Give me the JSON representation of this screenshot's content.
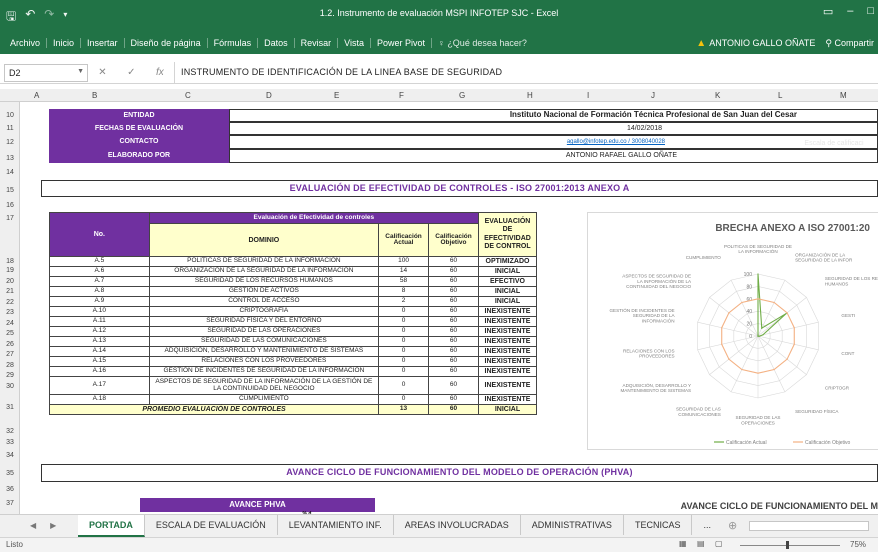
{
  "window": {
    "title": "1.2. Instrumento de evaluación  MSPI INFOTEP SJC - Excel",
    "controls": [
      "▭",
      "–",
      "□"
    ]
  },
  "ribbon": {
    "tabs": [
      "Archivo",
      "Inicio",
      "Insertar",
      "Diseño de página",
      "Fórmulas",
      "Datos",
      "Revisar",
      "Vista",
      "Power Pivot"
    ],
    "tell_me": "¿Qué desea hacer?",
    "user": "ANTONIO GALLO OÑATE",
    "share": "Compartir"
  },
  "formula_bar": {
    "name_box": "D2",
    "formula": "INSTRUMENTO DE IDENTIFICACIÓN DE LA LINEA BASE DE SEGURIDAD"
  },
  "columns": [
    "A",
    "B",
    "C",
    "D",
    "E",
    "F",
    "G",
    "H",
    "I",
    "J",
    "K",
    "L",
    "M"
  ],
  "rows": [
    "10",
    "11",
    "12",
    "13",
    "14",
    "15",
    "16",
    "17",
    "18",
    "19",
    "20",
    "21",
    "22",
    "23",
    "24",
    "25",
    "26",
    "27",
    "28",
    "29",
    "30",
    "31",
    "32",
    "33",
    "34",
    "35",
    "36",
    "37"
  ],
  "info": {
    "entidad_label": "ENTIDAD",
    "entidad_value": "Instituto Nacional de Formación Técnica Profesional de San Juan del Cesar",
    "fecha_label": "FECHAS DE EVALUACIÓN",
    "fecha_value": "14/02/2018",
    "contacto_label": "CONTACTO",
    "contacto_value": "agallo@infotep.edu.co / 3008040028",
    "elaborado_label": "ELABORADO POR",
    "elaborado_value": "ANTONIO RAFAEL GALLO OÑATE",
    "faded_right": "Escala de calificaci"
  },
  "section1_title": "EVALUACIÓN DE EFECTIVIDAD DE CONTROLES -  ISO 27001:2013 ANEXO A",
  "eval_table": {
    "group_header": "Evaluación de Efectividad de controles",
    "col_no": "No.",
    "col_dominio": "DOMINIO",
    "col_actual": "Calificación Actual",
    "col_objetivo": "Calificación Objetivo",
    "col_eval": "EVALUACIÓN DE EFECTIVIDAD DE CONTROL",
    "rows": [
      {
        "no": "A.5",
        "dominio": "POLITICAS DE SEGURIDAD DE LA INFORMACIÓN",
        "actual": "100",
        "objetivo": "60",
        "eval": "OPTIMIZADO"
      },
      {
        "no": "A.6",
        "dominio": "ORGANIZACIÓN DE LA SEGURIDAD DE LA INFORMACIÓN",
        "actual": "14",
        "objetivo": "60",
        "eval": "INICIAL"
      },
      {
        "no": "A.7",
        "dominio": "SEGURIDAD DE LOS RECURSOS HUMANOS",
        "actual": "58",
        "objetivo": "60",
        "eval": "EFECTIVO"
      },
      {
        "no": "A.8",
        "dominio": "GESTIÓN DE ACTIVOS",
        "actual": "8",
        "objetivo": "60",
        "eval": "INICIAL"
      },
      {
        "no": "A.9",
        "dominio": "CONTROL DE ACCESO",
        "actual": "2",
        "objetivo": "60",
        "eval": "INICIAL"
      },
      {
        "no": "A.10",
        "dominio": "CRIPTOGRAFÍA",
        "actual": "0",
        "objetivo": "60",
        "eval": "INEXISTENTE"
      },
      {
        "no": "A.11",
        "dominio": "SEGURIDAD FÍSICA Y DEL ENTORNO",
        "actual": "0",
        "objetivo": "60",
        "eval": "INEXISTENTE"
      },
      {
        "no": "A.12",
        "dominio": "SEGURIDAD DE LAS OPERACIONES",
        "actual": "0",
        "objetivo": "60",
        "eval": "INEXISTENTE"
      },
      {
        "no": "A.13",
        "dominio": "SEGURIDAD DE LAS COMUNICACIONES",
        "actual": "0",
        "objetivo": "60",
        "eval": "INEXISTENTE"
      },
      {
        "no": "A.14",
        "dominio": "ADQUISICIÓN, DESARROLLO Y MANTENIMIENTO DE SISTEMAS",
        "actual": "0",
        "objetivo": "60",
        "eval": "INEXISTENTE"
      },
      {
        "no": "A.15",
        "dominio": "RELACIONES CON LOS PROVEEDORES",
        "actual": "0",
        "objetivo": "60",
        "eval": "INEXISTENTE"
      },
      {
        "no": "A.16",
        "dominio": "GESTIÓN DE INCIDENTES DE SEGURIDAD DE LA INFORMACIÓN",
        "actual": "0",
        "objetivo": "60",
        "eval": "INEXISTENTE"
      },
      {
        "no": "A.17",
        "dominio": "ASPECTOS DE SEGURIDAD DE LA INFORMACIÓN DE LA GESTIÓN DE LA CONTINUIDAD DEL NEGOCIO",
        "actual": "0",
        "objetivo": "60",
        "eval": "INEXISTENTE"
      },
      {
        "no": "A.18",
        "dominio": "CUMPLIMIENTO",
        "actual": "0",
        "objetivo": "60",
        "eval": "INEXISTENTE"
      }
    ],
    "avg_label": "PROMEDIO EVALUACIÓN DE CONTROLES",
    "avg_actual": "13",
    "avg_objetivo": "60",
    "avg_eval": "INICIAL"
  },
  "section2_title": "AVANCE CICLO DE FUNCIONAMIENTO DEL MODELO DE OPERACIÓN (PHVA)",
  "phva": {
    "header": "AVANCE PHVA",
    "sub": "% d"
  },
  "chart2_title": "AVANCE CICLO DE FUNCIONAMIENTO DEL M",
  "chart_data": {
    "type": "radar",
    "title": "BRECHA ANEXO A ISO 27001:20",
    "axes": [
      "POLITICAS DE SEGURIDAD DE LA INFORMACIÓN",
      "ORGANIZACIÓN DE LA SEGURIDAD DE LA INFOR",
      "SEGURIDAD DE LOS RECURSOS HUMANOS",
      "GESTI",
      "CONT",
      "CRIPTOGR",
      "SEGURIDAD FÍSICA",
      "SEGURIDAD DE LAS OPERACIONES",
      "SEGURIDAD DE LAS COMUNICACIONES",
      "ADQUISICIÓN, DESARROLLO Y MANTENIMIENTO DE SISTEMAS",
      "RELACIONES CON LOS PROVEEDORES",
      "GESTIÓN DE INCIDENTES DE SEGURIDAD DE LA INFORMACIÓN",
      "ASPECTOS DE SEGURIDAD DE LA INFORMACIÓN DE LA CONTINUIDAD DEL NEGOCIO",
      "CUMPLIMIENTO"
    ],
    "axis_ticks": [
      0,
      20,
      40,
      60,
      80,
      100
    ],
    "series": [
      {
        "name": "Calificación Actual",
        "color": "#70ad47",
        "values": [
          100,
          14,
          58,
          8,
          2,
          0,
          0,
          0,
          0,
          0,
          0,
          0,
          0,
          0
        ]
      },
      {
        "name": "Calificación Objetivo",
        "color": "#f4b183",
        "values": [
          60,
          60,
          60,
          60,
          60,
          60,
          60,
          60,
          60,
          60,
          60,
          60,
          60,
          60
        ]
      }
    ]
  },
  "sheet_tabs": [
    "PORTADA",
    "ESCALA DE EVALUACIÓN",
    "LEVANTAMIENTO INF.",
    "AREAS INVOLUCRADAS",
    "ADMINISTRATIVAS",
    "TECNICAS",
    "..."
  ],
  "status": {
    "left": "Listo",
    "zoom": "75%"
  },
  "colors": {
    "excel_green": "#217346",
    "header_purple": "#7030a0",
    "header_yellow": "#ffffcc",
    "title_purple": "#7030a0"
  }
}
